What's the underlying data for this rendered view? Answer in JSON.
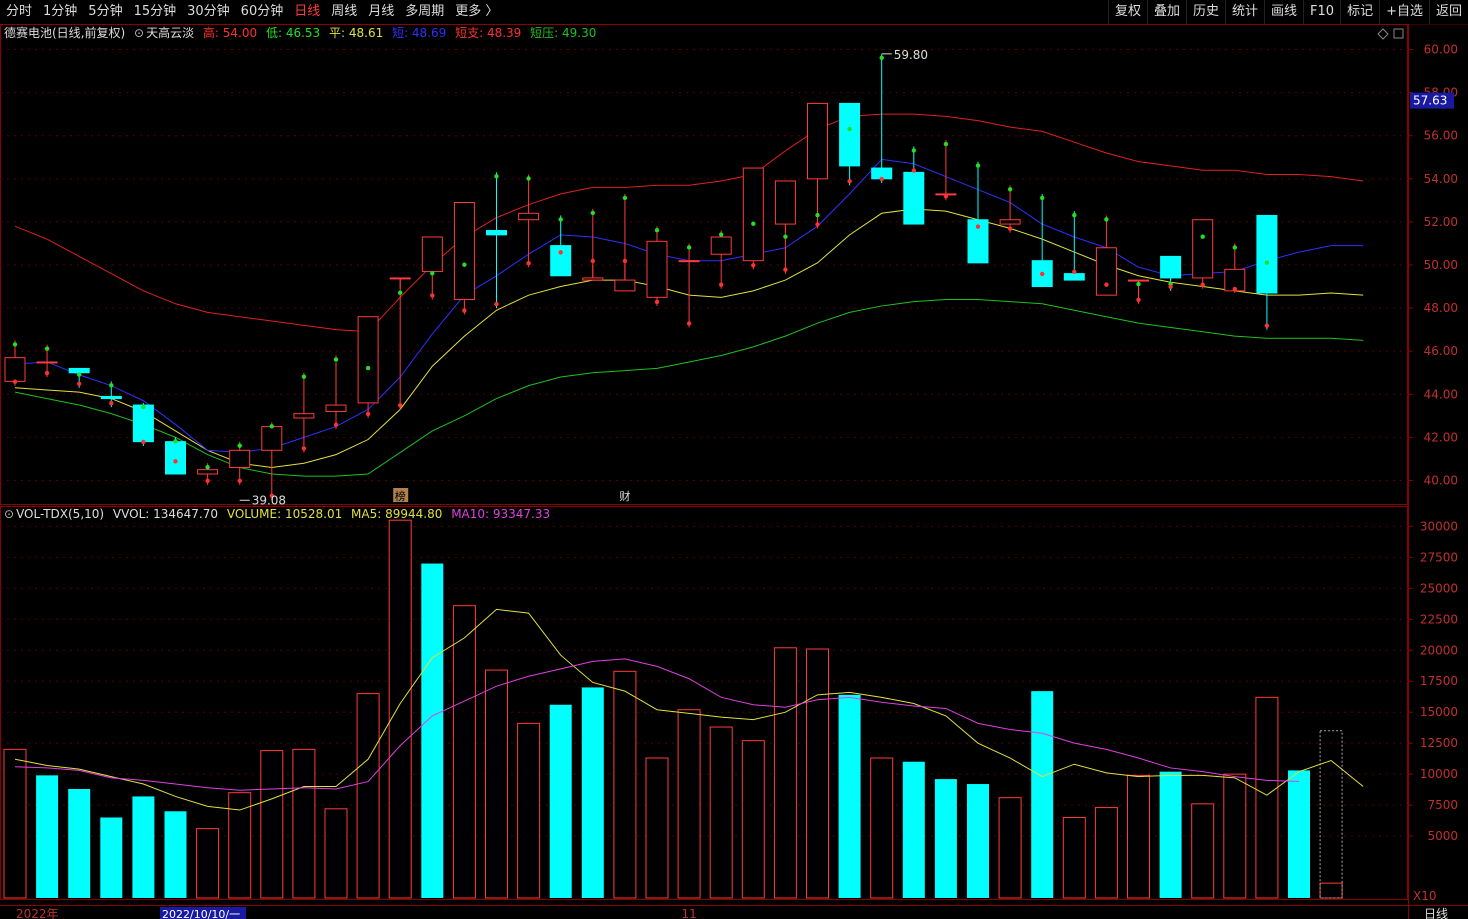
{
  "toolbar": {
    "tabs": [
      "分时",
      "1分钟",
      "5分钟",
      "15分钟",
      "30分钟",
      "60分钟",
      "日线",
      "周线",
      "月线",
      "多周期",
      "更多 〉"
    ],
    "active_tab": "日线",
    "tools": [
      "复权",
      "叠加",
      "历史",
      "统计",
      "画线",
      "F10",
      "标记",
      "+自选",
      "返回"
    ]
  },
  "price_panel": {
    "title": "德赛电池(日线,前复权)",
    "indicator": "天高云淡",
    "high_label": "高: 54.00",
    "low_label": "低: 46.53",
    "avg_label": "平: 48.61",
    "mid_label": "短: 48.69",
    "short_support_label": "短支: 48.39",
    "short_pressure_label": "短压: 49.30",
    "current_price_tag": "57.63",
    "high_marker": "59.80",
    "low_marker": "39.08",
    "event_markers": [
      "榜",
      "财"
    ],
    "colors": {
      "high": "#ff3030",
      "low": "#20e020",
      "avg": "#e0e040",
      "mid": "#3030ff",
      "support": "#ff3030",
      "pressure": "#20c020"
    }
  },
  "volume_panel": {
    "title": "VOL-TDX(5,10)",
    "vvol_label": "VVOL: 134647.70",
    "volume_label": "VOLUME: 10528.01",
    "ma5_label": "MA5: 89944.80",
    "ma10_label": "MA10: 93347.33",
    "multiplier": "X10"
  },
  "bottom_axis": {
    "labels": [
      "2022年",
      "2022/10/10/一",
      "11"
    ],
    "period": "日线"
  },
  "chart_data": [
    {
      "type": "candlestick",
      "title": "德赛电池(日线,前复权)",
      "ylim": [
        39,
        61
      ],
      "y_ticks": [
        40,
        42,
        44,
        46,
        48,
        50,
        52,
        54,
        56,
        58,
        60
      ],
      "open": [
        44.6,
        45.5,
        45.2,
        43.9,
        43.5,
        41.8,
        40.3,
        40.6,
        41.4,
        42.9,
        43.2,
        43.6,
        49.4,
        49.7,
        48.4,
        51.6,
        52.1,
        50.9,
        49.3,
        48.8,
        48.5,
        50.2,
        50.5,
        50.2,
        51.9,
        54.0,
        57.5,
        54.5,
        54.3,
        53.3,
        52.1,
        51.9,
        50.2,
        49.6,
        48.6,
        49.3,
        50.4,
        49.4,
        48.8,
        52.3,
        51.1,
        48.9
      ],
      "high": [
        46.5,
        46.3,
        45.1,
        44.6,
        43.6,
        42.0,
        40.8,
        41.8,
        42.7,
        45.0,
        45.8,
        45.4,
        48.9,
        49.8,
        50.2,
        54.3,
        54.2,
        52.3,
        52.6,
        53.3,
        51.8,
        51.0,
        51.6,
        52.1,
        51.5,
        52.5,
        56.5,
        59.8,
        55.5,
        55.8,
        54.8,
        53.7,
        53.3,
        52.5,
        52.3,
        49.3,
        49.3,
        51.5,
        51.0,
        50.3,
        52.9,
        51.5,
        49.3
      ],
      "low": [
        44.4,
        44.8,
        44.3,
        43.4,
        41.6,
        40.7,
        39.8,
        39.8,
        39.1,
        41.3,
        42.4,
        42.9,
        43.3,
        48.4,
        47.7,
        48.0,
        49.9,
        50.4,
        50.0,
        50.0,
        48.1,
        47.1,
        48.9,
        49.8,
        49.6,
        51.7,
        53.7,
        53.8,
        54.2,
        53.0,
        51.6,
        51.5,
        49.4,
        49.5,
        48.9,
        48.2,
        48.8,
        48.9,
        48.7,
        47.0,
        49.1,
        49.8,
        48.5
      ],
      "close": [
        45.7,
        45.5,
        45.0,
        43.8,
        41.8,
        40.3,
        40.5,
        41.4,
        42.5,
        43.1,
        43.5,
        47.6,
        49.4,
        51.3,
        52.9,
        51.4,
        52.4,
        49.5,
        49.4,
        49.3,
        51.1,
        50.2,
        51.3,
        54.5,
        53.9,
        57.5,
        54.6,
        54.0,
        51.9,
        53.3,
        50.1,
        52.1,
        49.0,
        49.3,
        50.8,
        49.3,
        49.4,
        52.1,
        49.8,
        48.7
      ],
      "ma_mid": [
        45.4,
        45.5,
        44.9,
        44.4,
        43.7,
        42.6,
        41.4,
        41.3,
        41.5,
        42.0,
        42.5,
        43.3,
        44.8,
        46.8,
        48.6,
        49.5,
        50.5,
        51.4,
        51.3,
        51.0,
        50.5,
        50.2,
        50.2,
        50.5,
        50.8,
        51.8,
        53.3,
        54.9,
        54.7,
        54.1,
        53.5,
        52.9,
        51.9,
        51.3,
        50.8,
        49.9,
        49.5,
        49.6,
        49.7,
        50.2,
        50.6,
        50.9,
        50.9
      ],
      "ma_avg": [
        44.3,
        44.2,
        44.1,
        43.8,
        43.2,
        42.3,
        41.4,
        40.8,
        40.6,
        40.8,
        41.2,
        41.9,
        43.3,
        45.3,
        46.7,
        47.9,
        48.6,
        49.0,
        49.3,
        49.3,
        49.0,
        48.6,
        48.5,
        48.8,
        49.3,
        50.1,
        51.4,
        52.4,
        52.6,
        52.5,
        52.1,
        51.7,
        51.2,
        50.6,
        50.0,
        49.5,
        49.2,
        49.0,
        48.8,
        48.6,
        48.6,
        48.7,
        48.6
      ],
      "ma_upper": [
        51.8,
        51.2,
        50.4,
        49.6,
        48.8,
        48.2,
        47.8,
        47.6,
        47.4,
        47.2,
        47.0,
        46.9,
        48.5,
        50.0,
        51.3,
        52.2,
        52.8,
        53.3,
        53.6,
        53.6,
        53.7,
        53.7,
        53.9,
        54.2,
        55.3,
        56.3,
        56.9,
        57.0,
        57.0,
        56.9,
        56.7,
        56.4,
        56.2,
        55.7,
        55.2,
        54.8,
        54.6,
        54.4,
        54.4,
        54.2,
        54.2,
        54.1,
        53.9
      ],
      "ma_lower": [
        44.1,
        43.8,
        43.5,
        43.1,
        42.6,
        42.0,
        41.2,
        40.6,
        40.3,
        40.2,
        40.2,
        40.3,
        41.3,
        42.3,
        43.0,
        43.8,
        44.4,
        44.8,
        45.0,
        45.1,
        45.2,
        45.5,
        45.8,
        46.2,
        46.7,
        47.3,
        47.8,
        48.1,
        48.3,
        48.4,
        48.4,
        48.3,
        48.2,
        47.9,
        47.6,
        47.3,
        47.1,
        46.9,
        46.7,
        46.6,
        46.6,
        46.6,
        46.5
      ]
    },
    {
      "type": "bar",
      "title": "VOL-TDX(5,10)",
      "ylim": [
        0,
        31000
      ],
      "y_ticks": [
        5000,
        7500,
        10000,
        12500,
        15000,
        17500,
        20000,
        22500,
        25000,
        27500,
        30000
      ],
      "values": [
        12000,
        9900,
        8800,
        6500,
        8200,
        7000,
        5600,
        8500,
        11900,
        12000,
        7200,
        16500,
        30500,
        27000,
        23600,
        18400,
        14100,
        15600,
        17000,
        18300,
        11300,
        15200,
        13800,
        12700,
        20200,
        20100,
        16400,
        11300,
        11000,
        9600,
        9200,
        8100,
        16700,
        6500,
        7300,
        9900,
        10200,
        7600,
        10000,
        16200,
        10300,
        1200
      ],
      "up": [
        true,
        false,
        false,
        false,
        false,
        false,
        true,
        true,
        true,
        true,
        true,
        true,
        true,
        false,
        true,
        true,
        true,
        false,
        false,
        true,
        true,
        true,
        true,
        true,
        true,
        true,
        false,
        true,
        false,
        false,
        false,
        true,
        false,
        true,
        true,
        true,
        false,
        true,
        true,
        true,
        false,
        true
      ],
      "ma5": [
        11200,
        10700,
        10400,
        9800,
        9200,
        8200,
        7400,
        7100,
        8000,
        9000,
        9000,
        11200,
        15700,
        19400,
        21000,
        23300,
        23000,
        19600,
        17400,
        16700,
        15200,
        14900,
        14600,
        14400,
        15000,
        16400,
        16600,
        16200,
        15700,
        14700,
        12500,
        11300,
        9800,
        10800,
        10100,
        9800,
        9900,
        9900,
        9700,
        8300,
        10200,
        11100,
        9000
      ],
      "ma10": [
        10600,
        10500,
        10300,
        9700,
        9500,
        9200,
        8900,
        8700,
        8800,
        8900,
        8800,
        9400,
        12300,
        14700,
        15900,
        17100,
        17900,
        18500,
        19100,
        19300,
        18700,
        17700,
        16200,
        15600,
        15400,
        16000,
        16200,
        15800,
        15500,
        15300,
        14100,
        13600,
        13300,
        12500,
        12000,
        11300,
        10500,
        10200,
        9800,
        9500,
        9400
      ]
    }
  ]
}
